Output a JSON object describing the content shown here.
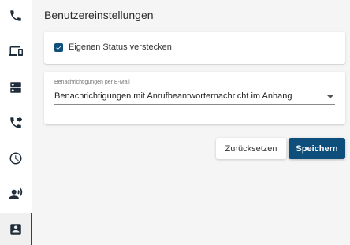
{
  "sidebar": {
    "items": [
      {
        "icon": "phone-icon"
      },
      {
        "icon": "devices-icon"
      },
      {
        "icon": "dns-icon"
      },
      {
        "icon": "phone-forwarded-icon"
      },
      {
        "icon": "history-icon"
      },
      {
        "icon": "record-voice-icon"
      },
      {
        "icon": "contact-card-icon",
        "active": true
      }
    ]
  },
  "page": {
    "title": "Benutzereinstellungen"
  },
  "status_card": {
    "checkbox_label": "Eigenen Status verstecken",
    "checked": true
  },
  "email_card": {
    "caption": "Benachrichtigungen per E-Mail",
    "selected_value": "Benachrichtigungen mit Anrufbeantworternachricht im Anhang"
  },
  "actions": {
    "reset_label": "Zurücksetzen",
    "save_label": "Speichern"
  },
  "colors": {
    "accent": "#0d4f7a",
    "background": "#f5f5f5"
  }
}
